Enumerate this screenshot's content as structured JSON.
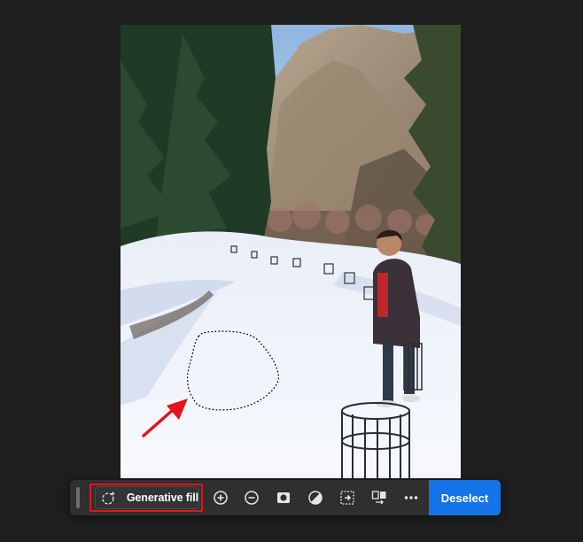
{
  "canvas": {
    "image_alt": "Snowy valley with pine trees, mountains and a boy standing on a fence post"
  },
  "taskbar": {
    "generative_fill_label": "Generative fill",
    "tools": [
      {
        "icon": "add-to-selection-icon"
      },
      {
        "icon": "subtract-from-selection-icon"
      },
      {
        "icon": "mask-icon"
      },
      {
        "icon": "invert-selection-icon"
      },
      {
        "icon": "transform-selection-icon"
      },
      {
        "icon": "fill-selection-icon"
      },
      {
        "icon": "more-options-icon"
      }
    ],
    "deselect_label": "Deselect"
  },
  "colors": {
    "accent": "#1473e6",
    "highlight": "#e3141a",
    "background": "#1e1e1e",
    "taskbar": "#2f2f2f"
  }
}
